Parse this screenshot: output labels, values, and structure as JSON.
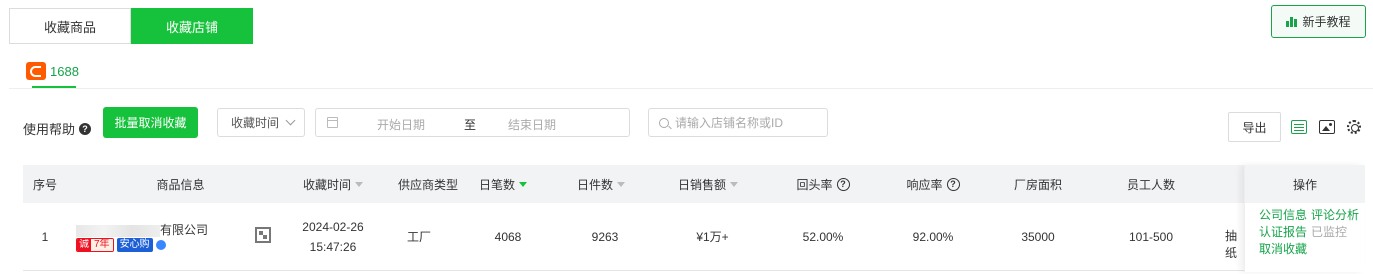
{
  "top_tabs": [
    {
      "label": "收藏商品",
      "active": false
    },
    {
      "label": "收藏店铺",
      "active": true
    }
  ],
  "tutorial_button": "新手教程",
  "platform_tab": {
    "label": "1688"
  },
  "filters": {
    "help_label": "使用帮助",
    "batch_cancel": "批量取消收藏",
    "sort_select": "收藏时间",
    "date_start_placeholder": "开始日期",
    "date_separator": "至",
    "date_end_placeholder": "结束日期",
    "search_placeholder": "请输入店铺名称或ID",
    "export": "导出"
  },
  "table": {
    "columns": [
      "序号",
      "商品信息",
      "收藏时间",
      "供应商类型",
      "日笔数",
      "日件数",
      "日销售额",
      "回头率",
      "响应率",
      "厂房面积",
      "员工人数",
      "操作"
    ],
    "rows": [
      {
        "index": "1",
        "company_suffix": "有限公司",
        "badge_seal_a": "诚",
        "badge_seal_b": "7年",
        "badge_safe": "安心购",
        "date": "2024-02-26",
        "time": "15:47:26",
        "supplier_type": "工厂",
        "daily_orders": "4068",
        "daily_items": "9263",
        "daily_sales": "¥1万+",
        "repurchase_rate": "52.00%",
        "response_rate": "92.00%",
        "factory_area": "35000",
        "employees": "101-500",
        "truncated": "抽纸",
        "actions": {
          "company_info": "公司信息",
          "review_analysis": "评论分析",
          "cert_report": "认证报告",
          "monitored": "已监控",
          "cancel_favorite": "取消收藏"
        }
      }
    ]
  },
  "colors": {
    "accent": "#16c23b",
    "link": "#16a34a"
  }
}
